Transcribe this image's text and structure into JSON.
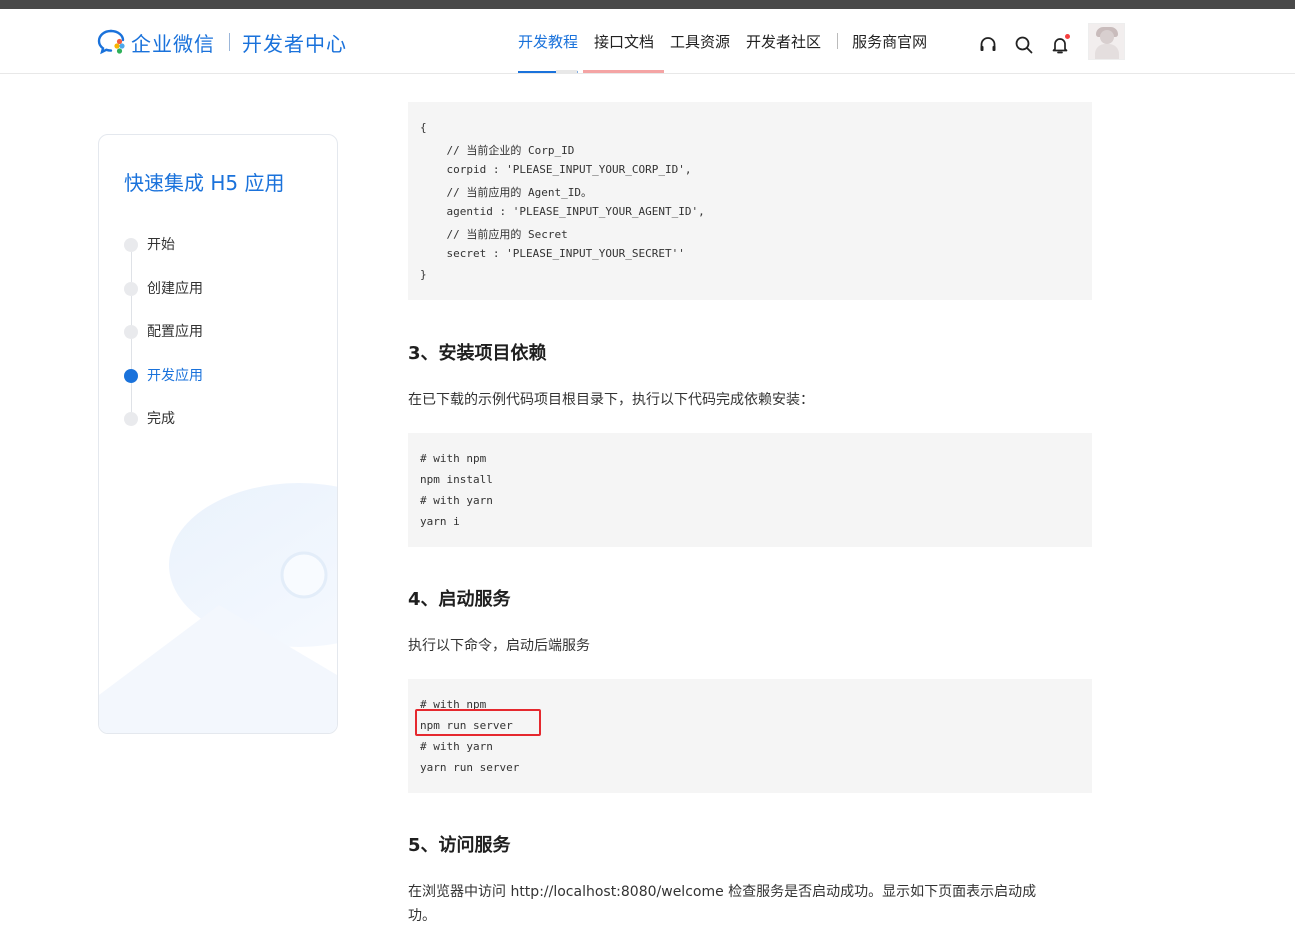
{
  "header": {
    "brand": "企业微信",
    "subbrand": "开发者中心",
    "nav": [
      {
        "label": "开发教程",
        "active": true
      },
      {
        "label": "接口文档",
        "active": false
      },
      {
        "label": "工具资源",
        "active": false
      },
      {
        "label": "开发者社区",
        "active": false
      },
      {
        "label": "服务商官网",
        "active": false
      }
    ],
    "icons": [
      "headset-icon",
      "search-icon",
      "bell-icon"
    ]
  },
  "sidebar": {
    "title": "快速集成 H5 应用",
    "steps": [
      {
        "label": "开始",
        "active": false
      },
      {
        "label": "创建应用",
        "active": false
      },
      {
        "label": "配置应用",
        "active": false
      },
      {
        "label": "开发应用",
        "active": true
      },
      {
        "label": "完成",
        "active": false
      }
    ]
  },
  "main": {
    "config_code": [
      "{",
      "    // 当前企业的 Corp_ID",
      "    corpid : 'PLEASE_INPUT_YOUR_CORP_ID',",
      "    // 当前应用的 Agent_ID。",
      "    agentid : 'PLEASE_INPUT_YOUR_AGENT_ID',",
      "    // 当前应用的 Secret",
      "    secret : 'PLEASE_INPUT_YOUR_SECRET''",
      "}"
    ],
    "section3_title": "3、安装项目依赖",
    "section3_desc": "在已下载的示例代码项目根目录下，执行以下代码完成依赖安装：",
    "install_code": [
      "# with npm",
      "npm install",
      "# with yarn",
      "yarn i"
    ],
    "section4_title": "4、启动服务",
    "section4_desc": "执行以下命令，启动后端服务",
    "server_code": [
      "# with npm",
      "npm run server",
      "# with yarn",
      "yarn run server"
    ],
    "section5_title": "5、访问服务",
    "section5_desc_line1": "在浏览器中访问 http://localhost:8080/welcome 检查服务是否启动成功。显示如下页面表示启动成",
    "section5_desc_line2": "功。"
  },
  "colors": {
    "accent": "#1a72db",
    "highlight": "#e5282e",
    "code_bg": "#f5f5f5"
  }
}
